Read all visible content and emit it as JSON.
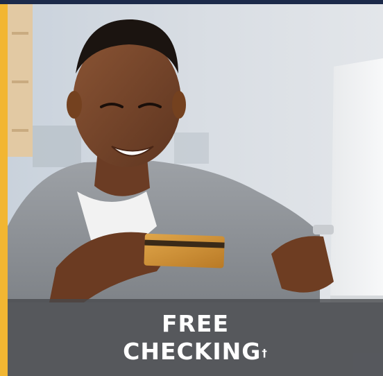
{
  "promo": {
    "headline_line1": "FREE",
    "headline_line2": "CHECKING",
    "footnote_mark": "†"
  },
  "colors": {
    "top_bar": "#1c2a4a",
    "accent": "#f2b632",
    "caption_band": "#46484c",
    "caption_text": "#ffffff"
  }
}
